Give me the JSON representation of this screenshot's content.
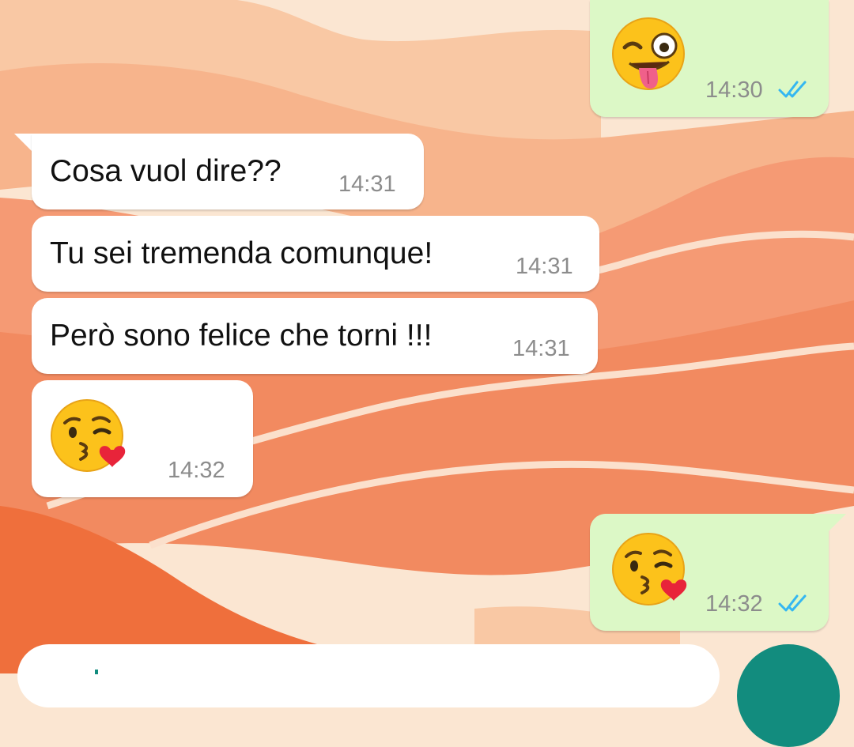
{
  "theme": {
    "incoming_bubble": "#ffffff",
    "outgoing_bubble": "#dcf8c6",
    "read_ticks": "#34b7f1",
    "send_button": "#128c7e"
  },
  "messages": [
    {
      "direction": "outgoing",
      "emoji": "winking-face-with-tongue",
      "time": "14:30",
      "status": "read"
    },
    {
      "direction": "incoming",
      "text": "Cosa vuol dire??",
      "time": "14:31"
    },
    {
      "direction": "incoming",
      "text": "Tu sei tremenda comunque!",
      "time": "14:31"
    },
    {
      "direction": "incoming",
      "text": "Però sono felice che torni !!!",
      "time": "14:31"
    },
    {
      "direction": "incoming",
      "emoji": "face-blowing-a-kiss",
      "time": "14:32"
    },
    {
      "direction": "outgoing",
      "emoji": "face-blowing-a-kiss",
      "time": "14:32",
      "status": "read"
    }
  ],
  "composer": {
    "value": ""
  }
}
